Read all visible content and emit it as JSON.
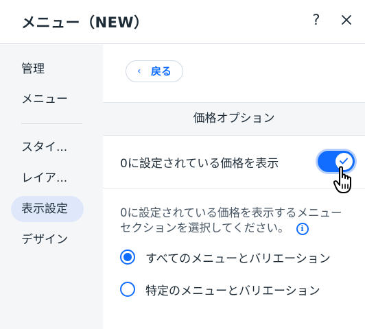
{
  "header": {
    "title": "メニュー（NEW）",
    "help_label": "?",
    "close_icon": "close-icon"
  },
  "sidebar": {
    "items": [
      {
        "label": "管理"
      },
      {
        "label": "メニュー"
      },
      {
        "label": "スタイ..."
      },
      {
        "label": "レイア..."
      },
      {
        "label": "表示設定",
        "active": true
      },
      {
        "label": "デザイン"
      }
    ]
  },
  "main": {
    "back_label": "戻る",
    "section_title": "価格オプション",
    "toggle": {
      "label": "0に設定されている価格を表示",
      "on": true
    },
    "description_line1": "0に設定されている価格を表示するメニュー",
    "description_line2": "セクションを選択してください。",
    "info_icon_glyph": "i",
    "radio_options": [
      {
        "label": "すべてのメニューとバリエーション",
        "checked": true
      },
      {
        "label": "特定のメニューとバリエーション",
        "checked": false
      }
    ]
  },
  "colors": {
    "accent": "#116dff",
    "sidebar_bg": "#f4f6f8",
    "active_item_bg": "#dfe8fb"
  }
}
